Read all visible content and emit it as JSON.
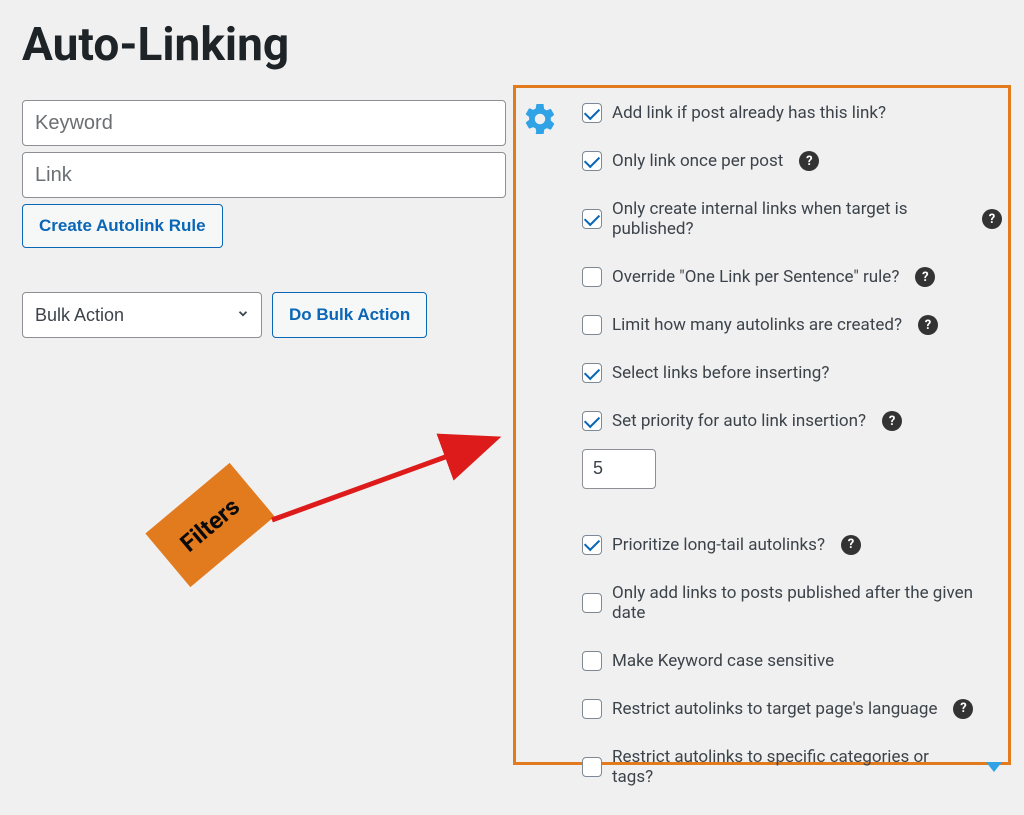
{
  "title": "Auto-Linking",
  "inputs": {
    "keyword_placeholder": "Keyword",
    "link_placeholder": "Link"
  },
  "buttons": {
    "create_rule": "Create Autolink Rule",
    "do_bulk": "Do Bulk Action"
  },
  "bulk_select": {
    "current": "Bulk Action"
  },
  "annotation": {
    "filters_label": "Filters"
  },
  "options": [
    {
      "label": "Add link if post already has this link?",
      "checked": true,
      "help": false
    },
    {
      "label": "Only link once per post",
      "checked": true,
      "help": true
    },
    {
      "label": "Only create internal links when target is published?",
      "checked": true,
      "help": true
    },
    {
      "label": "Override \"One Link per Sentence\" rule?",
      "checked": false,
      "help": true
    },
    {
      "label": "Limit how many autolinks are created?",
      "checked": false,
      "help": true
    },
    {
      "label": "Select links before inserting?",
      "checked": true,
      "help": false
    },
    {
      "label": "Set priority for auto link insertion?",
      "checked": true,
      "help": true
    },
    {
      "label": "Prioritize long-tail autolinks?",
      "checked": true,
      "help": true
    },
    {
      "label": "Only add links to posts published after the given date",
      "checked": false,
      "help": false
    },
    {
      "label": "Make Keyword case sensitive",
      "checked": false,
      "help": false
    },
    {
      "label": "Restrict autolinks to target page's language",
      "checked": false,
      "help": true
    },
    {
      "label": "Restrict autolinks to specific categories or tags?",
      "checked": false,
      "help": false,
      "caret": true
    }
  ],
  "priority_value": "5"
}
